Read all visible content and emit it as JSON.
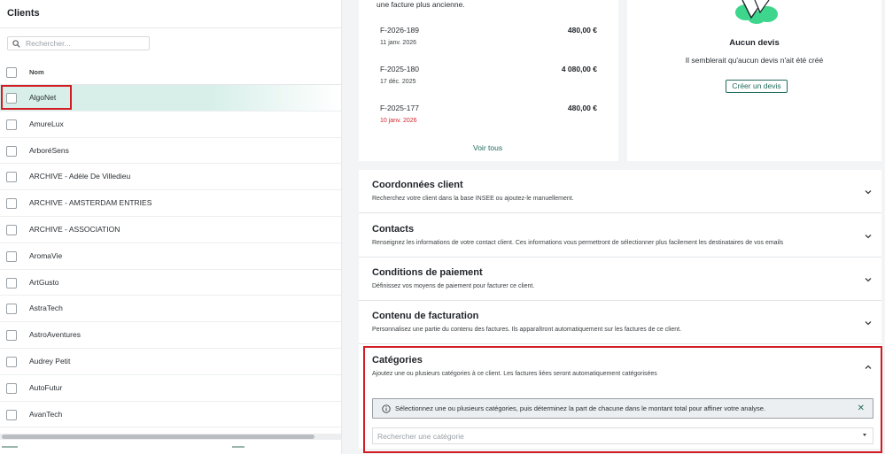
{
  "clients_panel": {
    "title": "Clients",
    "search_placeholder": "Rechercher...",
    "column_header": "Nom",
    "rows": [
      {
        "name": "AlgoNet",
        "highlighted": true
      },
      {
        "name": "AmureLux"
      },
      {
        "name": "ArboréSens"
      },
      {
        "name": "ARCHIVE - Adèle De Villedieu"
      },
      {
        "name": "ARCHIVE - AMSTERDAM ENTRIES"
      },
      {
        "name": "ARCHIVE - ASSOCIATION"
      },
      {
        "name": "AromaVie"
      },
      {
        "name": "ArtGusto"
      },
      {
        "name": "AstraTech"
      },
      {
        "name": "AstroAventures"
      },
      {
        "name": "Audrey Petit"
      },
      {
        "name": "AutoFutur"
      },
      {
        "name": "AvanTech"
      }
    ]
  },
  "invoices_card": {
    "intro": "une facture plus ancienne.",
    "invoices": [
      {
        "number": "F-2026-189",
        "date": "11 janv. 2026",
        "amount": "480,00 €",
        "overdue": false
      },
      {
        "number": "F-2025-180",
        "date": "17 déc. 2025",
        "amount": "4 080,00 €",
        "overdue": false
      },
      {
        "number": "F-2025-177",
        "date": "10 janv. 2026",
        "amount": "480,00 €",
        "overdue": true
      }
    ],
    "see_all": "Voir tous"
  },
  "quotes_card": {
    "title": "Aucun devis",
    "subtitle": "Il semblerait qu'aucun devis n'ait été créé",
    "create_button": "Créer un devis"
  },
  "sections": [
    {
      "title": "Coordonnées client",
      "description": "Recherchez votre client dans la base INSEE ou ajoutez-le manuellement.",
      "expanded": false
    },
    {
      "title": "Contacts",
      "description": "Renseignez les informations de votre contact client. Ces informations vous permettront de sélectionner plus facilement les destinataires de vos emails",
      "expanded": false
    },
    {
      "title": "Conditions de paiement",
      "description": "Définissez vos moyens de paiement pour facturer ce client.",
      "expanded": false
    },
    {
      "title": "Contenu de facturation",
      "description": "Personnalisez une partie du contenu des factures. Ils apparaîtront automatiquement sur les factures de ce client.",
      "expanded": false
    },
    {
      "title": "Catégories",
      "description": "Ajoutez une ou plusieurs catégories à ce client. Les factures liées seront automatiquement catégorisées",
      "expanded": true
    }
  ],
  "categories": {
    "info_text": "Sélectionnez une ou plusieurs catégories, puis déterminez la part de chacune dans le montant total pour affiner votre analyse.",
    "close_symbol": "✕",
    "search_placeholder": "Rechercher une catégorie"
  },
  "colors": {
    "accent": "#1f6b5d",
    "highlight_row": "#d8efe9",
    "annotation_red": "#d21c24",
    "overdue": "#d0262e"
  }
}
